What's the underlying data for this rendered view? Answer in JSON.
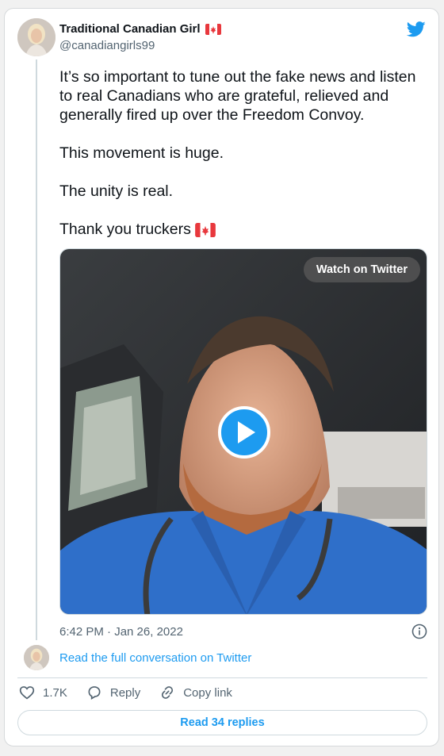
{
  "tweet": {
    "display_name": "Traditional Canadian Girl",
    "handle": "@canadiangirls99",
    "paragraphs": [
      "It’s so important to tune out the fake news and listen to real Canadians who are grateful, relieved and generally fired up over the Freedom Convoy.",
      "This movement is huge.",
      "The unity is real.",
      "Thank you truckers"
    ],
    "timestamp": "6:42 PM · Jan 26, 2022"
  },
  "media": {
    "watch_label": "Watch on Twitter"
  },
  "conversation": {
    "read_full_label": "Read the full conversation on Twitter"
  },
  "actions": {
    "likes": "1.7K",
    "reply_label": "Reply",
    "copy_label": "Copy link"
  },
  "footer": {
    "read_replies_label": "Read 34 replies"
  },
  "colors": {
    "accent": "#1d9bf0",
    "secondary_text": "#536471",
    "scrubs": "#2f6fc9"
  },
  "icons": [
    "canada-flag-icon",
    "twitter-bird-icon",
    "play-icon",
    "info-icon",
    "heart-icon",
    "reply-icon",
    "link-icon"
  ]
}
